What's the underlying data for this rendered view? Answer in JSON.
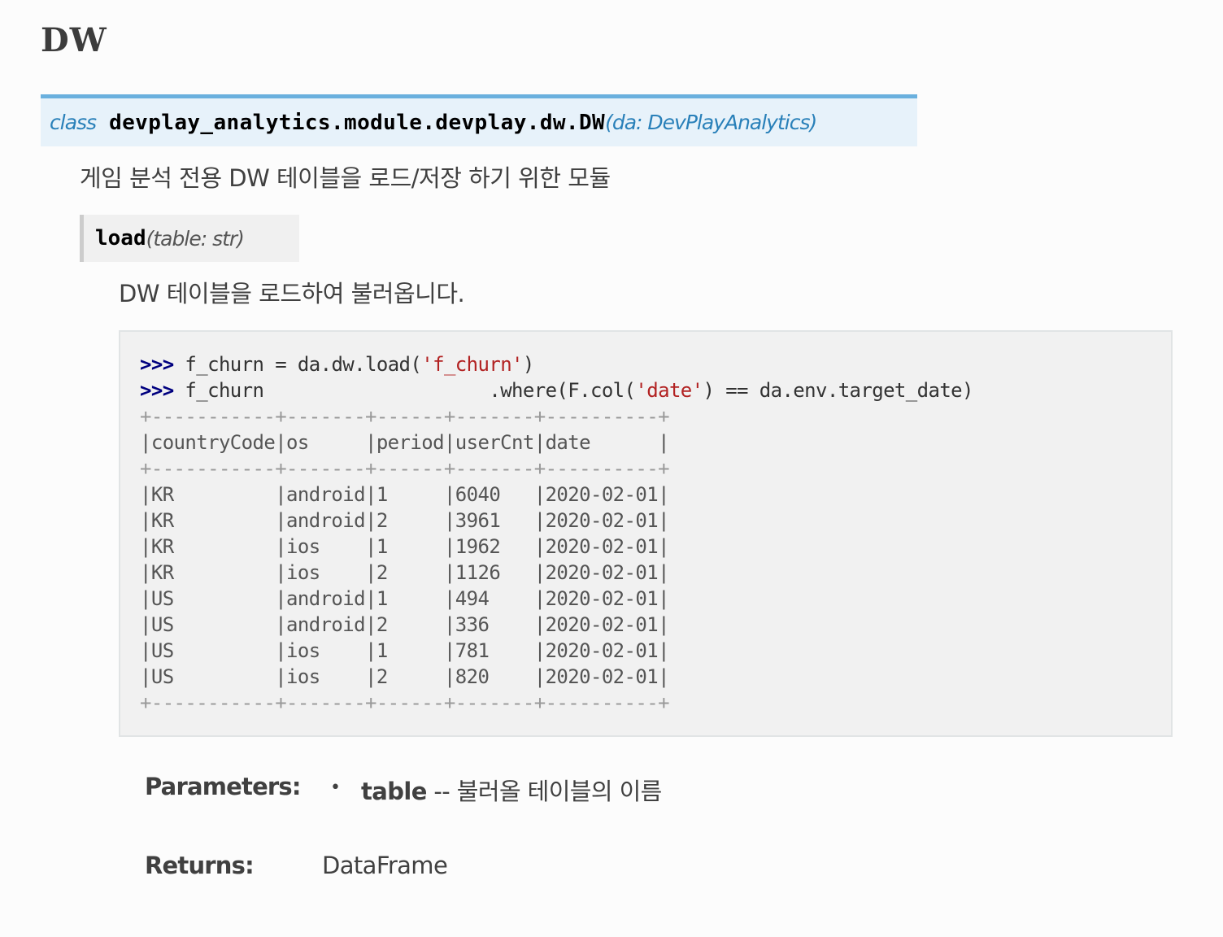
{
  "page": {
    "title": "DW"
  },
  "class_signature": {
    "keyword": "class",
    "name": "devplay_analytics.module.devplay.dw.DW",
    "params": "(da: DevPlayAnalytics)"
  },
  "class_description": "게임 분석 전용 DW 테이블을 로드/저장 하기 위한 모듈",
  "method": {
    "name": "load",
    "params": "(table: str)",
    "description": "DW 테이블을 로드하여 불러옵니다."
  },
  "code_example": {
    "prompt": ">>>",
    "line1_prefix": " f_churn = da.dw.load(",
    "line1_string": "'f_churn'",
    "line1_suffix": ")",
    "line2_prefix": " f_churn                    .where(F.col(",
    "line2_string": "'date'",
    "line2_suffix": ") == da.env.target_date)",
    "table_border": "+-----------+-------+------+-------+----------+",
    "table_header": "|countryCode|os     |period|userCnt|date      |",
    "table_rows": [
      "|KR         |android|1     |6040   |2020-02-01|",
      "|KR         |android|2     |3961   |2020-02-01|",
      "|KR         |ios    |1     |1962   |2020-02-01|",
      "|KR         |ios    |2     |1126   |2020-02-01|",
      "|US         |android|1     |494    |2020-02-01|",
      "|US         |android|2     |336    |2020-02-01|",
      "|US         |ios    |1     |781    |2020-02-01|",
      "|US         |ios    |2     |820    |2020-02-01|"
    ]
  },
  "fields": {
    "parameters_label": "Parameters:",
    "param_bullet": "•",
    "param_name": "table",
    "param_desc": " -- 불러올 테이블의 이름",
    "returns_label": "Returns:",
    "returns_value": "DataFrame"
  }
}
